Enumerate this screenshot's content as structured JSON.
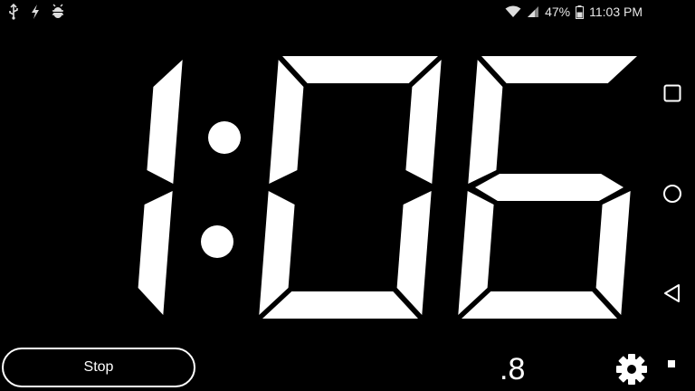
{
  "status_bar": {
    "icons_left": [
      "usb-icon",
      "lightning-icon",
      "android-debug-icon"
    ],
    "wifi_icon": "wifi-icon",
    "signal_icon": "signal-icon",
    "battery_percent": "47%",
    "battery_icon": "battery-icon",
    "time": "11:03 PM"
  },
  "timer": {
    "display": "1:06",
    "minutes": "1",
    "seconds": "06",
    "tenths": ".8"
  },
  "controls": {
    "stop_label": "Stop",
    "settings_icon": "gear-icon"
  },
  "nav": {
    "items": [
      "recent-apps-icon",
      "home-icon",
      "back-icon"
    ]
  },
  "colors": {
    "background": "#000000",
    "foreground": "#ffffff"
  }
}
